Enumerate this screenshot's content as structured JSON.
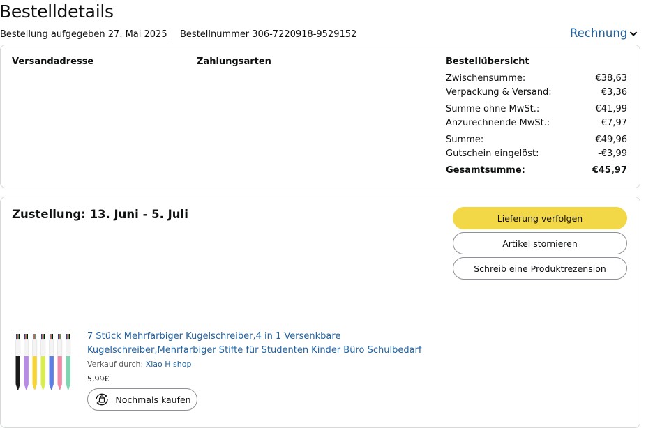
{
  "header": {
    "title": "Bestelldetails",
    "order_date": "Bestellung aufgegeben 27. Mai 2025",
    "order_number": "Bestellnummer 306-7220918-9529152",
    "invoice_label": "Rechnung"
  },
  "details": {
    "shipping_heading": "Versandadresse",
    "payment_heading": "Zahlungsarten",
    "summary_heading": "Bestellübersicht",
    "summary_rows": [
      {
        "label": "Zwischensumme:",
        "value": "€38,63"
      },
      {
        "label": "Verpackung & Versand:",
        "value": "€3,36"
      },
      {
        "label": "Summe ohne MwSt.:",
        "value": "€41,99"
      },
      {
        "label": "Anzurechnende MwSt.:",
        "value": "€7,97"
      },
      {
        "label": "Summe:",
        "value": "€49,96"
      },
      {
        "label": "Gutschein eingelöst:",
        "value": "-€3,99"
      },
      {
        "label": "Gesamtsumme:",
        "value": "€45,97"
      }
    ]
  },
  "delivery": {
    "title": "Zustellung: 13. Juni - 5. Juli",
    "buttons": {
      "track": "Lieferung verfolgen",
      "cancel": "Artikel stornieren",
      "review": "Schreib eine Produktrezension"
    }
  },
  "product": {
    "title": "7 Stück Mehrfarbiger Kugelschreiber,4 in 1 Versenkbare Kugelschreiber,Mehrfarbiger Stifte für Studenten Kinder Büro Schulbedarf",
    "seller_prefix": "Verkauf durch: ",
    "seller_name": "Xiao H shop",
    "price": "5,99€",
    "buy_again_label": "Nochmals kaufen",
    "image_icon": "multicolor-pens-image",
    "pen_colors": [
      "#1a1a1a",
      "#b98be8",
      "#f5d33a",
      "#d8ee4c",
      "#5b7fe6",
      "#f08aa6",
      "#7ed6b0"
    ]
  },
  "colors": {
    "link": "#2162a1",
    "track_button": "#f2d747",
    "border": "#d5d9d9"
  }
}
